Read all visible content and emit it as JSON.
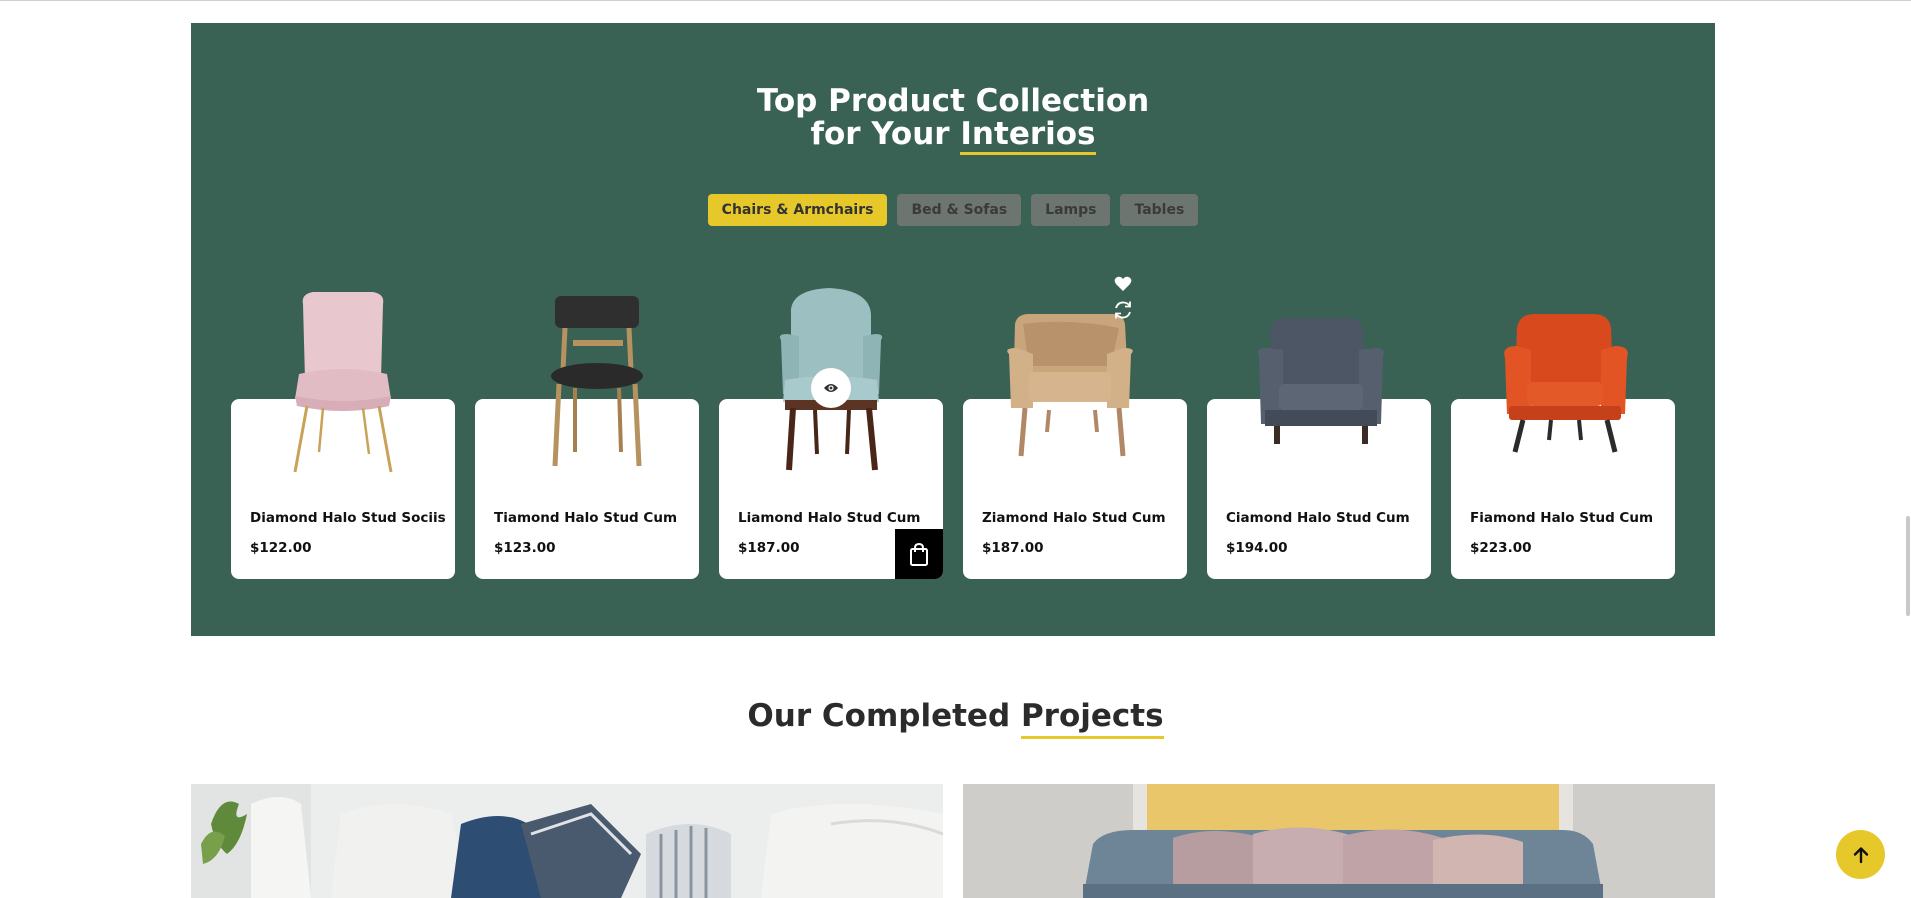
{
  "collection": {
    "title_line1": "Top Product Collection",
    "title_line2_prefix": "for Your ",
    "title_line2_highlight": "Interios",
    "tabs": [
      {
        "label": "Chairs & Armchairs",
        "active": true
      },
      {
        "label": "Bed & Sofas",
        "active": false
      },
      {
        "label": "Lamps",
        "active": false
      },
      {
        "label": "Tables",
        "active": false
      }
    ],
    "products": [
      {
        "name": "Diamond Halo Stud Sociis",
        "price": "$122.00",
        "color": "#e8c7cf"
      },
      {
        "name": "Tiamond Halo Stud Cum",
        "price": "$123.00",
        "color": "#2f2f2f"
      },
      {
        "name": "Liamond Halo Stud Cum",
        "price": "$187.00",
        "color": "#9cc0c2"
      },
      {
        "name": "Ziamond Halo Stud Cum",
        "price": "$187.00",
        "color": "#c9a57c"
      },
      {
        "name": "Ciamond Halo Stud Cum",
        "price": "$194.00",
        "color": "#4d5664"
      },
      {
        "name": "Fiamond Halo Stud Cum",
        "price": "$223.00",
        "color": "#d84a1e"
      }
    ]
  },
  "projects": {
    "title_prefix": "Our Completed ",
    "title_highlight": "Projects"
  },
  "colors": {
    "section_bg": "#3a6254",
    "accent": "#e6c82b"
  }
}
